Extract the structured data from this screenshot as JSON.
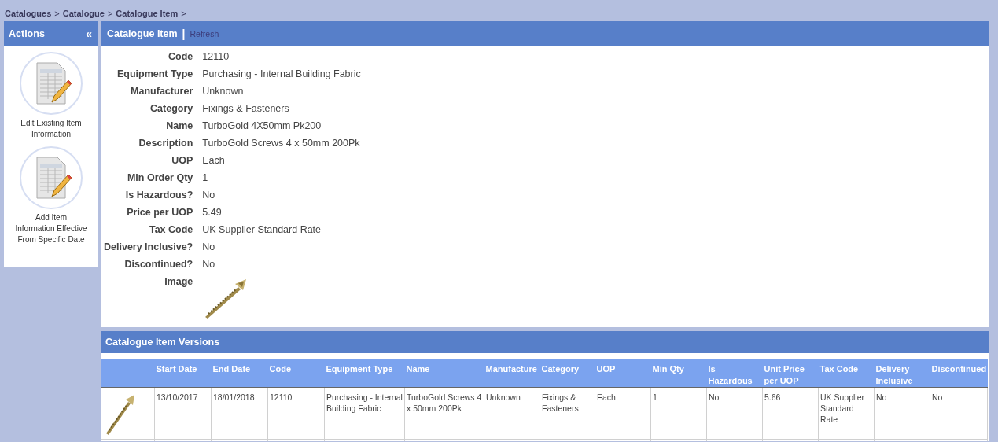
{
  "breadcrumb": [
    {
      "label": "Catalogues",
      "separator": ">"
    },
    {
      "label": "Catalogue",
      "separator": ">"
    },
    {
      "label": "Catalogue Item",
      "separator": ">"
    }
  ],
  "sidebar": {
    "title": "Actions",
    "collapse": "«",
    "actions": [
      {
        "label": "Edit Existing Item Information"
      },
      {
        "label": "Add Item Information Effective From Specific Date"
      }
    ]
  },
  "details": {
    "title": "Catalogue Item",
    "divider": "|",
    "refresh": "Refresh",
    "fields": [
      {
        "label": "Code",
        "value": "12110"
      },
      {
        "label": "Equipment Type",
        "value": "Purchasing - Internal Building Fabric"
      },
      {
        "label": "Manufacturer",
        "value": "Unknown"
      },
      {
        "label": "Category",
        "value": "Fixings & Fasteners"
      },
      {
        "label": "Name",
        "value": "TurboGold 4X50mm Pk200"
      },
      {
        "label": "Description",
        "value": "TurboGold Screws 4 x 50mm 200Pk"
      },
      {
        "label": "UOP",
        "value": "Each"
      },
      {
        "label": "Min Order Qty",
        "value": "1"
      },
      {
        "label": "Is Hazardous?",
        "value": "No"
      },
      {
        "label": "Price per UOP",
        "value": "5.49"
      },
      {
        "label": "Tax Code",
        "value": "UK Supplier Standard Rate"
      },
      {
        "label": "Delivery Inclusive?",
        "value": "No"
      },
      {
        "label": "Discontinued?",
        "value": "No"
      },
      {
        "label": "Image",
        "kind": "picture"
      }
    ]
  },
  "versions": {
    "title": "Catalogue Item Versions",
    "columns": [
      "",
      "Start Date",
      "End Date",
      "Code",
      "Equipment Type",
      "Name",
      "Manufacture",
      "Category",
      "UOP",
      "Min Qty",
      "Is Hazardous",
      "Unit Price per UOP",
      "Tax Code",
      "Delivery Inclusive",
      "Discontinued"
    ],
    "rows": [
      [
        "",
        "13/10/2017",
        "18/01/2018",
        "12110",
        "Purchasing - Internal Building Fabric",
        "TurboGold Screws 4 x 50mm 200Pk",
        "Unknown",
        "Fixings & Fasteners",
        "Each",
        "1",
        "No",
        "5.66",
        "UK Supplier Standard Rate",
        "No",
        "No"
      ]
    ]
  }
}
